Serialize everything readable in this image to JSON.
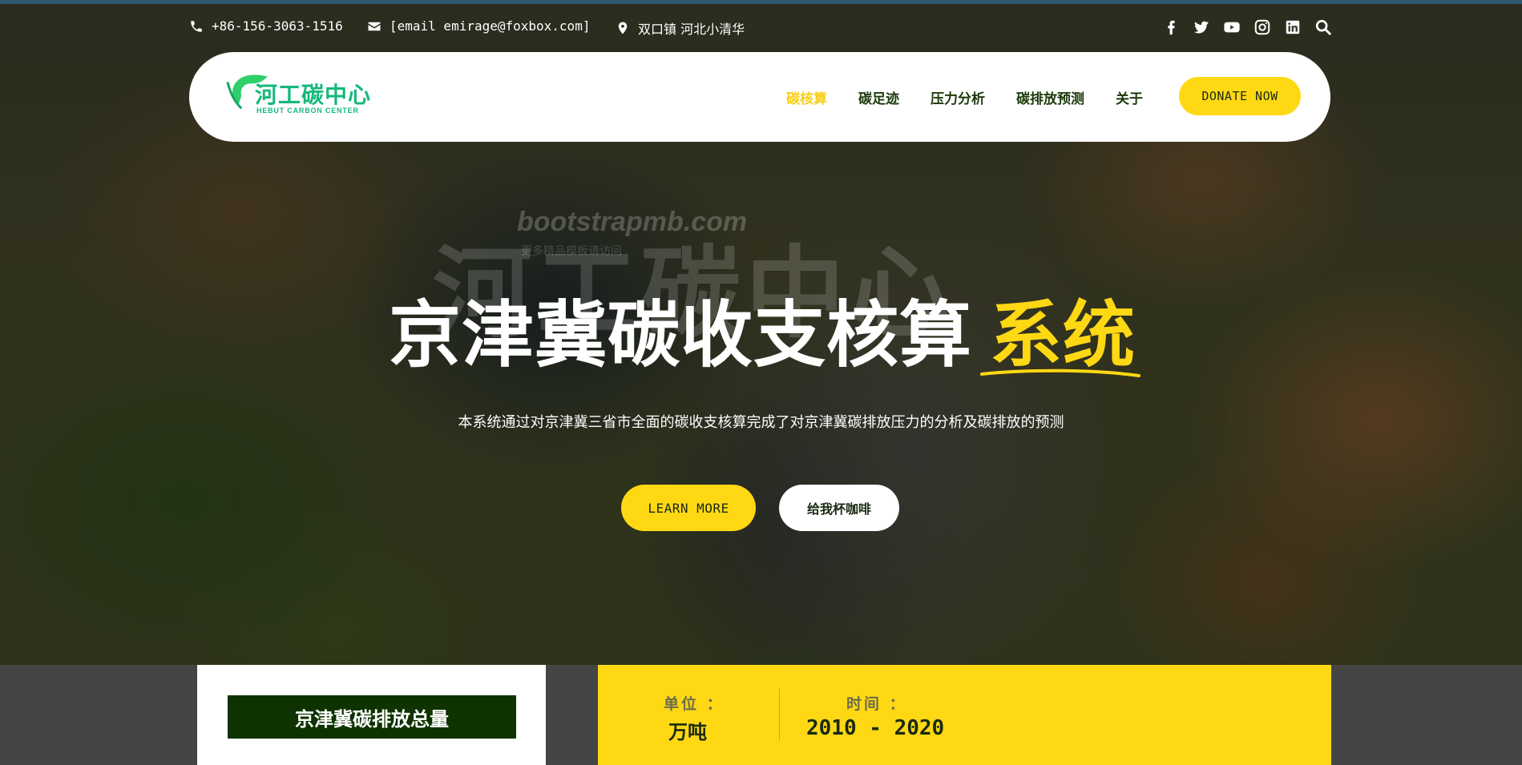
{
  "topbar": {
    "phone": "+86-156-3063-1516",
    "email": "[email emirage@foxbox.com]",
    "location": "双口镇 河北小清华",
    "social_icons": [
      "facebook-icon",
      "twitter-icon",
      "youtube-icon",
      "instagram-icon",
      "linkedin-icon",
      "search-icon"
    ]
  },
  "logo": {
    "text": "河工碳中心",
    "subtitle": "HEBUT CARBON CENTER"
  },
  "nav": {
    "items": [
      {
        "label": "碳核算",
        "active": true
      },
      {
        "label": "碳足迹",
        "active": false
      },
      {
        "label": "压力分析",
        "active": false
      },
      {
        "label": "碳排放预测",
        "active": false
      },
      {
        "label": "关于",
        "active": false
      }
    ],
    "donate_label": "DONATE NOW"
  },
  "watermark": {
    "big": "河工碳中心",
    "site": "bootstrapmb.com",
    "sub": "更多精品模板请访问"
  },
  "hero": {
    "title_main": "京津冀碳收支核算",
    "title_highlight": "系统",
    "description": "本系统通过对京津冀三省市全面的碳收支核算完成了对京津冀碳排放压力的分析及碳排放的预测",
    "learn_more_label": "LEARN MORE",
    "coffee_label": "给我杯咖啡"
  },
  "stats": {
    "total_label": "京津冀碳排放总量",
    "unit_label": "单位 ：",
    "unit_value": "万吨",
    "time_label": "时间 ：",
    "time_value": "2010 - 2020"
  },
  "colors": {
    "accent": "#ffd814",
    "nav_text": "#1c3a0c",
    "logo_green": "#15b87b",
    "dark_green": "#0e3300"
  }
}
